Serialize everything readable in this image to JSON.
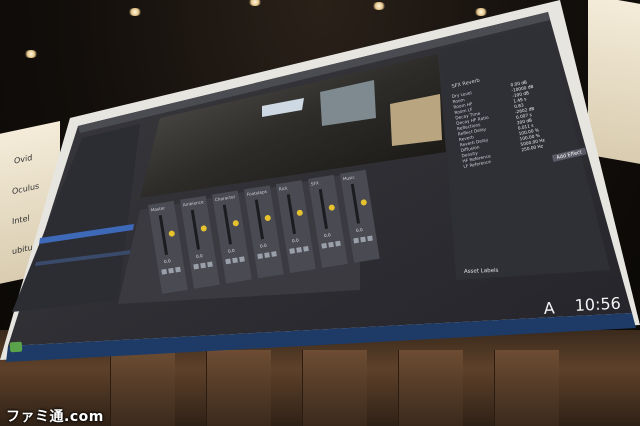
{
  "watermark": "ファミ通.com",
  "banner_left": [
    "Ovid",
    "Oculus",
    "Intel",
    "ubitus"
  ],
  "screen": {
    "asset_labels_title": "Asset Labels",
    "add_effect_label": "Add Effect",
    "effect_header": "SFX Reverb",
    "effect_params": [
      {
        "name": "Dry Level",
        "value": "0.00 dB"
      },
      {
        "name": "Room",
        "value": "-10000 dB"
      },
      {
        "name": "Room HF",
        "value": "-100 dB"
      },
      {
        "name": "Room LF",
        "value": "1.49 s"
      },
      {
        "name": "Decay Time",
        "value": "0.83"
      },
      {
        "name": "Decay HF Ratio",
        "value": "-2602 dB"
      },
      {
        "name": "Reflections",
        "value": "0.007 s"
      },
      {
        "name": "Reflect Delay",
        "value": "200 dB"
      },
      {
        "name": "Reverb",
        "value": "0.011 s"
      },
      {
        "name": "Reverb Delay",
        "value": "100.00 %"
      },
      {
        "name": "Diffusion",
        "value": "100.00 %"
      },
      {
        "name": "Density",
        "value": "5000.00 Hz"
      },
      {
        "name": "HF Reference",
        "value": "250.00 Hz"
      },
      {
        "name": "LF Reference",
        "value": ""
      }
    ],
    "mixer_channels": [
      {
        "name": "Master",
        "value": "0.0"
      },
      {
        "name": "Ambience",
        "value": "0.0"
      },
      {
        "name": "Character",
        "value": "0.0"
      },
      {
        "name": "Footsteps",
        "value": "0.0"
      },
      {
        "name": "Rick",
        "value": "0.0"
      },
      {
        "name": "SFX",
        "value": "0.0"
      },
      {
        "name": "Music",
        "value": "0.0"
      }
    ],
    "taskbar_time": "10:56",
    "taskbar_ime": "A"
  }
}
